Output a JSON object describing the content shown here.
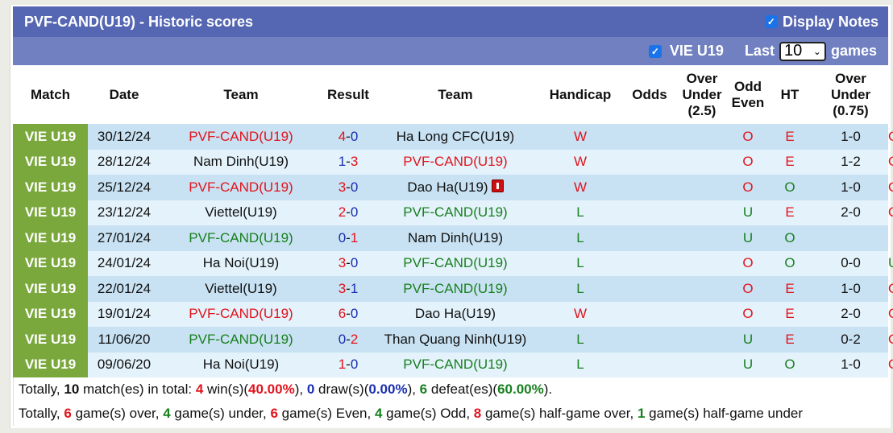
{
  "header": {
    "title": "PVF-CAND(U19) - Historic scores",
    "display_notes_label": "Display Notes",
    "display_notes_checked": true
  },
  "filter": {
    "league_label": "VIE U19",
    "league_checked": true,
    "last_label": "Last",
    "games_count": "10",
    "games_label": "games"
  },
  "columns": [
    "Match",
    "Date",
    "Team",
    "Result",
    "Team",
    "Handicap",
    "Odds",
    "Over Under (2.5)",
    "Odd Even",
    "HT",
    "Over Under (0.75)"
  ],
  "column_lines": {
    "ou25": [
      "Over",
      "Under",
      "(2.5)"
    ],
    "oddeven": [
      "Odd",
      "Even"
    ],
    "ou075": [
      "Over",
      "Under",
      "(0.75)"
    ]
  },
  "rows": [
    {
      "league": "VIE U19",
      "date": "30/12/24",
      "home": "PVF-CAND(U19)",
      "home_color": "red",
      "score_home": "4",
      "score_away": "0",
      "away": "Ha Long CFC(U19)",
      "away_color": "black",
      "away_redcard": false,
      "result": "W",
      "handicap": "",
      "odds": "",
      "ou": "O",
      "oe": "E",
      "ht": "1-0",
      "ou075": "O"
    },
    {
      "league": "VIE U19",
      "date": "28/12/24",
      "home": "Nam Dinh(U19)",
      "home_color": "black",
      "score_home": "1",
      "score_away": "3",
      "away": "PVF-CAND(U19)",
      "away_color": "red",
      "away_redcard": false,
      "result": "W",
      "handicap": "",
      "odds": "",
      "ou": "O",
      "oe": "E",
      "ht": "1-2",
      "ou075": "O"
    },
    {
      "league": "VIE U19",
      "date": "25/12/24",
      "home": "PVF-CAND(U19)",
      "home_color": "red",
      "score_home": "3",
      "score_away": "0",
      "away": "Dao Ha(U19)",
      "away_color": "black",
      "away_redcard": true,
      "result": "W",
      "handicap": "",
      "odds": "",
      "ou": "O",
      "oe": "O",
      "ht": "1-0",
      "ou075": "O"
    },
    {
      "league": "VIE U19",
      "date": "23/12/24",
      "home": "Viettel(U19)",
      "home_color": "black",
      "score_home": "2",
      "score_away": "0",
      "away": "PVF-CAND(U19)",
      "away_color": "green",
      "away_redcard": false,
      "result": "L",
      "handicap": "",
      "odds": "",
      "ou": "U",
      "oe": "E",
      "ht": "2-0",
      "ou075": "O"
    },
    {
      "league": "VIE U19",
      "date": "27/01/24",
      "home": "PVF-CAND(U19)",
      "home_color": "green",
      "score_home": "0",
      "score_away": "1",
      "away": "Nam Dinh(U19)",
      "away_color": "black",
      "away_redcard": false,
      "result": "L",
      "handicap": "",
      "odds": "",
      "ou": "U",
      "oe": "O",
      "ht": "",
      "ou075": ""
    },
    {
      "league": "VIE U19",
      "date": "24/01/24",
      "home": "Ha Noi(U19)",
      "home_color": "black",
      "score_home": "3",
      "score_away": "0",
      "away": "PVF-CAND(U19)",
      "away_color": "green",
      "away_redcard": false,
      "result": "L",
      "handicap": "",
      "odds": "",
      "ou": "O",
      "oe": "O",
      "ht": "0-0",
      "ou075": "U"
    },
    {
      "league": "VIE U19",
      "date": "22/01/24",
      "home": "Viettel(U19)",
      "home_color": "black",
      "score_home": "3",
      "score_away": "1",
      "away": "PVF-CAND(U19)",
      "away_color": "green",
      "away_redcard": false,
      "result": "L",
      "handicap": "",
      "odds": "",
      "ou": "O",
      "oe": "E",
      "ht": "1-0",
      "ou075": "O"
    },
    {
      "league": "VIE U19",
      "date": "19/01/24",
      "home": "PVF-CAND(U19)",
      "home_color": "red",
      "score_home": "6",
      "score_away": "0",
      "away": "Dao Ha(U19)",
      "away_color": "black",
      "away_redcard": false,
      "result": "W",
      "handicap": "",
      "odds": "",
      "ou": "O",
      "oe": "E",
      "ht": "2-0",
      "ou075": "O"
    },
    {
      "league": "VIE U19",
      "date": "11/06/20",
      "home": "PVF-CAND(U19)",
      "home_color": "green",
      "score_home": "0",
      "score_away": "2",
      "away": "Than Quang Ninh(U19)",
      "away_color": "black",
      "away_redcard": false,
      "result": "L",
      "handicap": "",
      "odds": "",
      "ou": "U",
      "oe": "E",
      "ht": "0-2",
      "ou075": "O"
    },
    {
      "league": "VIE U19",
      "date": "09/06/20",
      "home": "Ha Noi(U19)",
      "home_color": "black",
      "score_home": "1",
      "score_away": "0",
      "away": "PVF-CAND(U19)",
      "away_color": "green",
      "away_redcard": false,
      "result": "L",
      "handicap": "",
      "odds": "",
      "ou": "U",
      "oe": "O",
      "ht": "1-0",
      "ou075": "O"
    }
  ],
  "summary": {
    "line1": [
      {
        "t": "Totally, ",
        "c": "black",
        "b": false
      },
      {
        "t": "10",
        "c": "black",
        "b": true
      },
      {
        "t": " match(es) in total: ",
        "c": "black",
        "b": false
      },
      {
        "t": "4",
        "c": "red",
        "b": true
      },
      {
        "t": " win(s)(",
        "c": "black",
        "b": false
      },
      {
        "t": "40.00%",
        "c": "red",
        "b": true
      },
      {
        "t": "), ",
        "c": "black",
        "b": false
      },
      {
        "t": "0",
        "c": "blue",
        "b": true
      },
      {
        "t": " draw(s)(",
        "c": "black",
        "b": false
      },
      {
        "t": "0.00%",
        "c": "blue",
        "b": true
      },
      {
        "t": "), ",
        "c": "black",
        "b": false
      },
      {
        "t": "6",
        "c": "green",
        "b": true
      },
      {
        "t": " defeat(es)(",
        "c": "black",
        "b": false
      },
      {
        "t": "60.00%",
        "c": "green",
        "b": true
      },
      {
        "t": ").",
        "c": "black",
        "b": false
      }
    ],
    "line2": [
      {
        "t": "Totally, ",
        "c": "black",
        "b": false
      },
      {
        "t": "6",
        "c": "red",
        "b": true
      },
      {
        "t": " game(s) over, ",
        "c": "black",
        "b": false
      },
      {
        "t": "4",
        "c": "green",
        "b": true
      },
      {
        "t": " game(s) under, ",
        "c": "black",
        "b": false
      },
      {
        "t": "6",
        "c": "red",
        "b": true
      },
      {
        "t": " game(s) Even, ",
        "c": "black",
        "b": false
      },
      {
        "t": "4",
        "c": "green",
        "b": true
      },
      {
        "t": " game(s) Odd, ",
        "c": "black",
        "b": false
      },
      {
        "t": "8",
        "c": "red",
        "b": true
      },
      {
        "t": " game(s) half-game over, ",
        "c": "black",
        "b": false
      },
      {
        "t": "1",
        "c": "green",
        "b": true
      },
      {
        "t": " game(s) half-game under",
        "c": "black",
        "b": false
      }
    ]
  },
  "colors": {
    "title_bar": "#5566b2",
    "sub_bar": "#7080c0",
    "league_cell": "#7aa83c",
    "row_odd": "#c8e2f3",
    "row_even": "#e3f2fb",
    "win": "#e2141c",
    "loss": "#18801e",
    "draw": "#1a2fb0"
  }
}
